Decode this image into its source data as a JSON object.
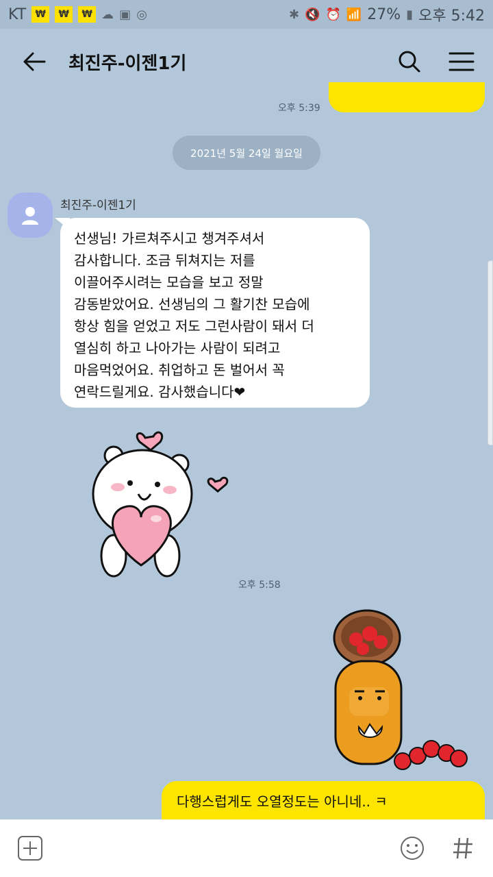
{
  "status_bar": {
    "carrier": "KT",
    "won_badges": [
      "₩",
      "₩",
      "₩"
    ],
    "battery": "27%",
    "time": "오후 5:42"
  },
  "app_bar": {
    "title": "최진주-이젠1기"
  },
  "messages": {
    "prev_time": "오후 5:39",
    "date_divider": "2021년 5월 24일 월요일",
    "sender_name": "최진주-이젠1기",
    "text": "선생님! 가르쳐주시고 챙겨주셔서\n감사합니다. 조금 뒤쳐지는 저를\n이끌어주시려는 모습을 보고 정말\n감동받았어요. 선생님의 그 활기찬 모습에\n항상 힘을 얻었고 저도 그런사람이 돼서 더\n열심히 하고 나아가는 사람이 되려고\n마음먹었어요. 취업하고 돈 벌어서 꼭\n연락드릴게요. 감사했습니다❤",
    "sticker_time": "오후 5:58",
    "reply_line1": "다행스럽게도 오열정도는 아니네.. ㅋ"
  },
  "colors": {
    "background": "#b2c7da",
    "my_bubble": "#fee500",
    "their_bubble": "#ffffff"
  },
  "icons": [
    "back-arrow-icon",
    "search-icon",
    "menu-icon",
    "add-icon",
    "emoji-icon",
    "hash-icon"
  ]
}
